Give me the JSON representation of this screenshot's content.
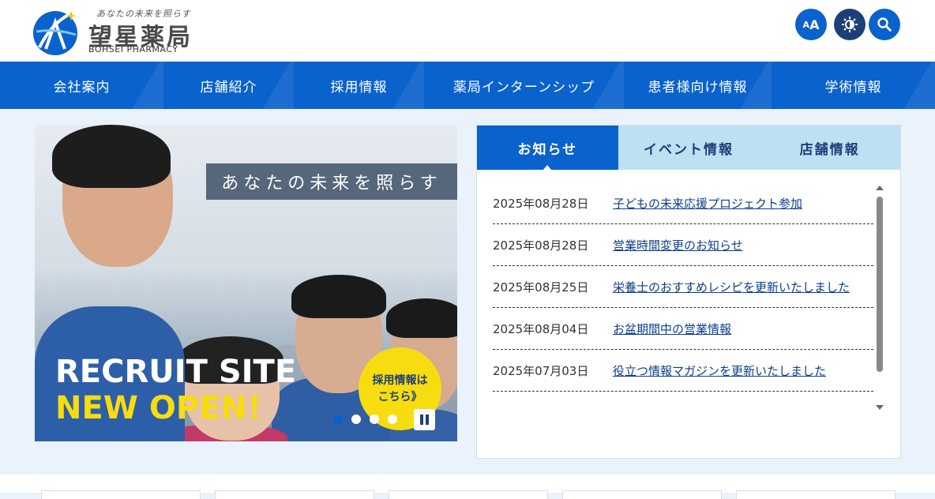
{
  "header": {
    "logo_tagline": "あなたの未来を照らす",
    "logo_name": "望星薬局",
    "logo_en": "BOHSEI PHARMACY",
    "font_size_big": "A",
    "font_size_small": "A"
  },
  "nav": {
    "items": [
      {
        "label": "会社案内"
      },
      {
        "label": "店舗紹介"
      },
      {
        "label": "採用情報"
      },
      {
        "label": "薬局インターンシップ"
      },
      {
        "label": "患者様向け情報"
      },
      {
        "label": "学術情報"
      }
    ]
  },
  "hero": {
    "tagline": "あなたの未来を照らす",
    "line1": "RECRUIT SITE",
    "line2": "NEW OPEN!",
    "badge_line1": "採用情報は",
    "badge_line2": "こちら》"
  },
  "tabs": [
    {
      "label": "お知らせ",
      "active": true
    },
    {
      "label": "イベント情報",
      "active": false
    },
    {
      "label": "店舗情報",
      "active": false
    }
  ],
  "news": [
    {
      "date": "2025年08月28日",
      "title": "子どもの未来応援プロジェクト参加"
    },
    {
      "date": "2025年08月28日",
      "title": "営業時間変更のお知らせ"
    },
    {
      "date": "2025年08月25日",
      "title": "栄養士のおすすめレシピを更新いたしました"
    },
    {
      "date": "2025年08月04日",
      "title": "お盆期間中の営業情報"
    },
    {
      "date": "2025年07月03日",
      "title": "役立つ情報マガジンを更新いたしました"
    }
  ],
  "colors": {
    "primary": "#0a62cc",
    "dark": "#1d3f78",
    "accent_yellow": "#f7dc10",
    "tab_inactive": "#bde0f2"
  }
}
